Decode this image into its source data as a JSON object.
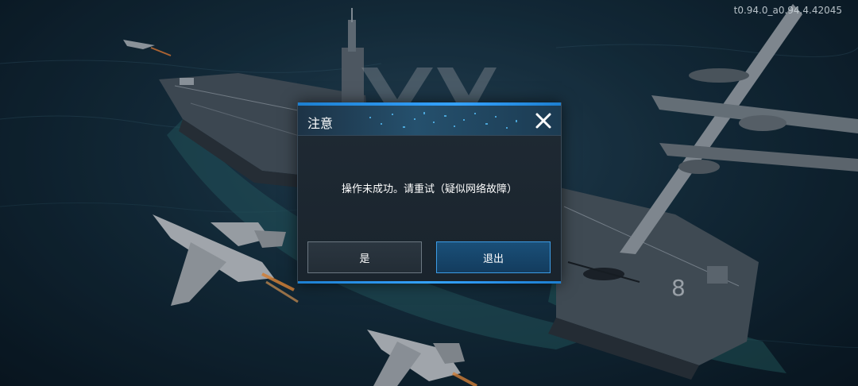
{
  "version": "t0.94.0_a0.94.4.42045",
  "dialog": {
    "title": "注意",
    "message": "操作未成功。请重试（疑似网络故障）",
    "yes_label": "是",
    "exit_label": "退出",
    "close_icon": "close-icon"
  },
  "colors": {
    "accent_blue": "#35a3ff",
    "exit_button_bg": "#1a4f78",
    "yes_button_border": "#6c7882"
  }
}
